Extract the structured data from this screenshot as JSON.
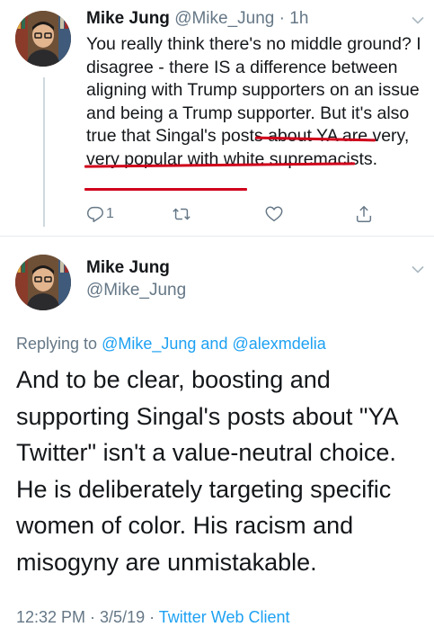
{
  "reply_tweet": {
    "author_name": "Mike Jung",
    "author_handle": "@Mike_Jung",
    "separator": "·",
    "time_ago": "1h",
    "text_plain": "You really think there's no middle ground? I disagree - there IS a difference between aligning with Trump supporters on an issue and being a Trump supporter. But it's also true that ",
    "text_underlined": "Singal's posts about YA are very, very popular with white supremacists.",
    "underline_color": "#d0021b",
    "reply_count": "1",
    "action_icons": [
      "reply-icon",
      "retweet-icon",
      "like-icon",
      "share-icon"
    ]
  },
  "main_tweet": {
    "author_name": "Mike Jung",
    "author_handle": "@Mike_Jung",
    "replying_prefix": "Replying to",
    "replying_user1": "@Mike_Jung",
    "replying_and": "and",
    "replying_user2": "@alexmdelia",
    "text": "And to be clear, boosting and supporting Singal's posts about \"YA Twitter\" isn't a value-neutral choice. He is deliberately targeting specific women of color. His racism and misogyny are unmistakable.",
    "timestamp": "12:32 PM · 3/5/19 ·",
    "client": "Twitter Web Client"
  },
  "colors": {
    "link": "#1da1f2",
    "secondary_text": "#657786",
    "primary_text": "#14171a",
    "highlight_underline": "#d0021b"
  }
}
